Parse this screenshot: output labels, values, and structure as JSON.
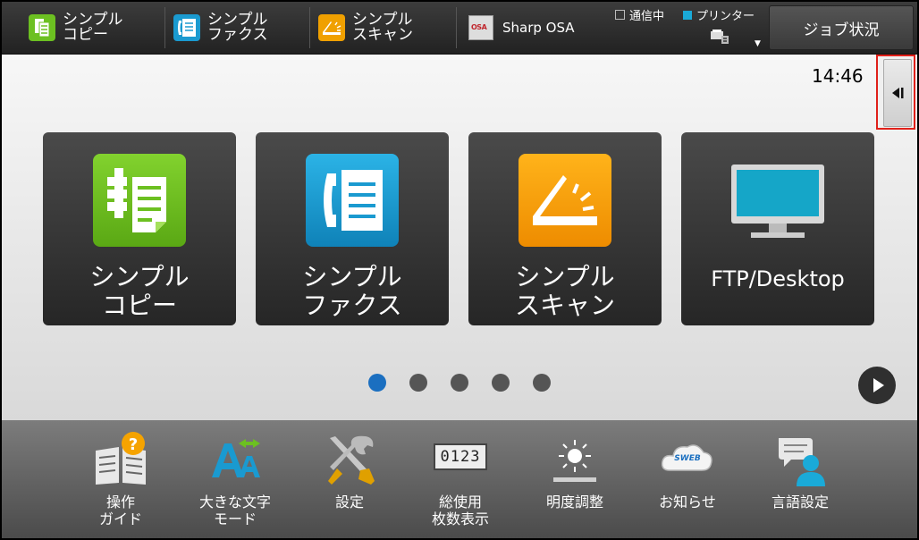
{
  "topbar": {
    "shortcuts": [
      {
        "label": "シンプル\nコピー"
      },
      {
        "label": "シンプル\nファクス"
      },
      {
        "label": "シンプル\nスキャン"
      }
    ],
    "osa": {
      "label": "Sharp OSA",
      "icon_text": "OSA"
    },
    "status": {
      "communicating": "通信中",
      "printer": "プリンター"
    },
    "job_status_button": "ジョブ状況"
  },
  "main": {
    "clock": "14:46",
    "tiles": [
      {
        "label": "シンプル\nコピー"
      },
      {
        "label": "シンプル\nファクス"
      },
      {
        "label": "シンプル\nスキャン"
      },
      {
        "label": "FTP/Desktop"
      }
    ],
    "pages": {
      "count": 5,
      "current": 1
    }
  },
  "bottombar": {
    "items": [
      {
        "label": "操作\nガイド"
      },
      {
        "label": "大きな文字\nモード"
      },
      {
        "label": "設定"
      },
      {
        "label": "総使用\n枚数表示",
        "counter_digits": "0123"
      },
      {
        "label": "明度調整"
      },
      {
        "label": "お知らせ",
        "icon_text": "SWEB"
      },
      {
        "label": "言語設定"
      }
    ]
  },
  "colors": {
    "copy": "#6cc021",
    "fax": "#1a9ad0",
    "scan": "#f0a000",
    "active_dot": "#1b6fc0",
    "highlight": "#e0201a"
  }
}
